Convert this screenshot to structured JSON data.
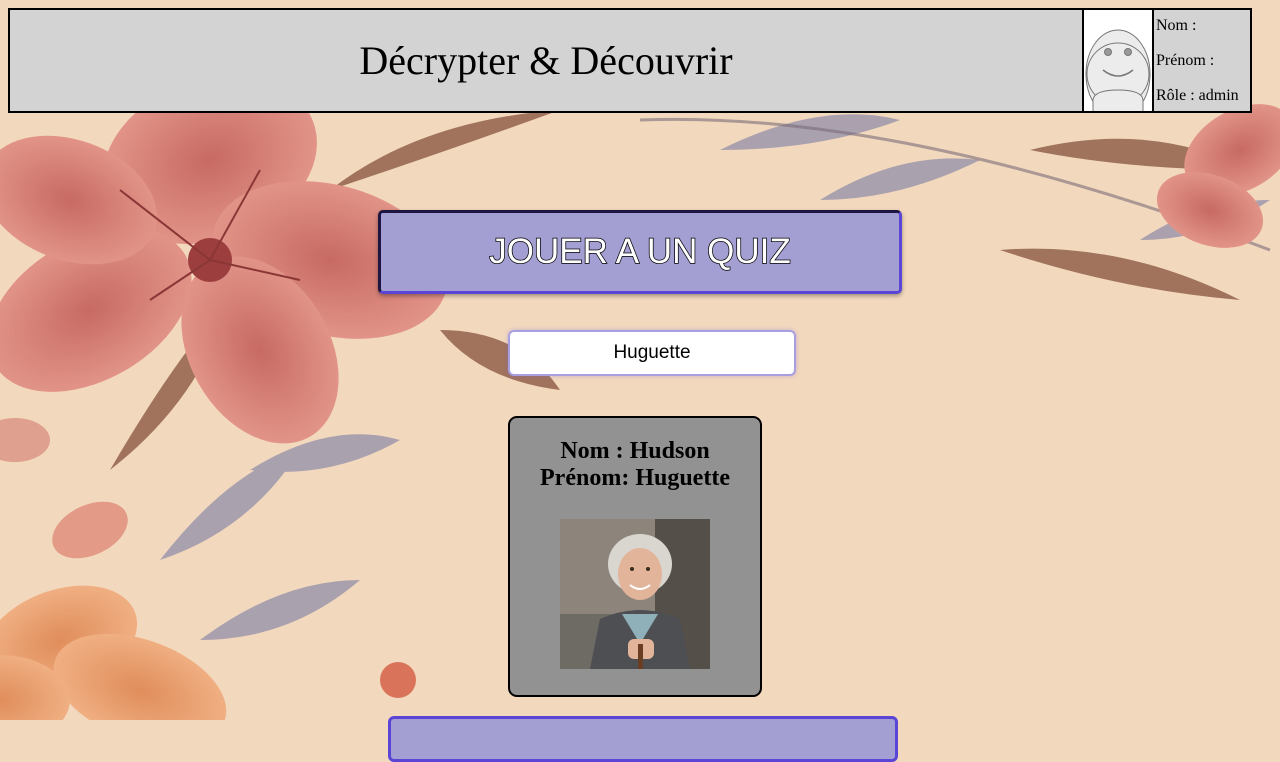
{
  "header": {
    "title": "Décrypter & Découvrir",
    "user": {
      "nom_label": "Nom :",
      "prenom_label": "Prénom :",
      "role_label": "Rôle : admin"
    }
  },
  "quiz_button": {
    "label": "JOUER A UN QUIZ"
  },
  "user_select": {
    "selected": "Huguette"
  },
  "person_card": {
    "nom_line": "Nom : Hudson",
    "prenom_line": "Prénom: Huguette"
  },
  "colors": {
    "header_bg": "#d3d3d3",
    "button_bg": "#a49fd3",
    "button_border": "#5b45d6",
    "card_bg": "#929292",
    "page_bg": "#f2d8bd"
  }
}
